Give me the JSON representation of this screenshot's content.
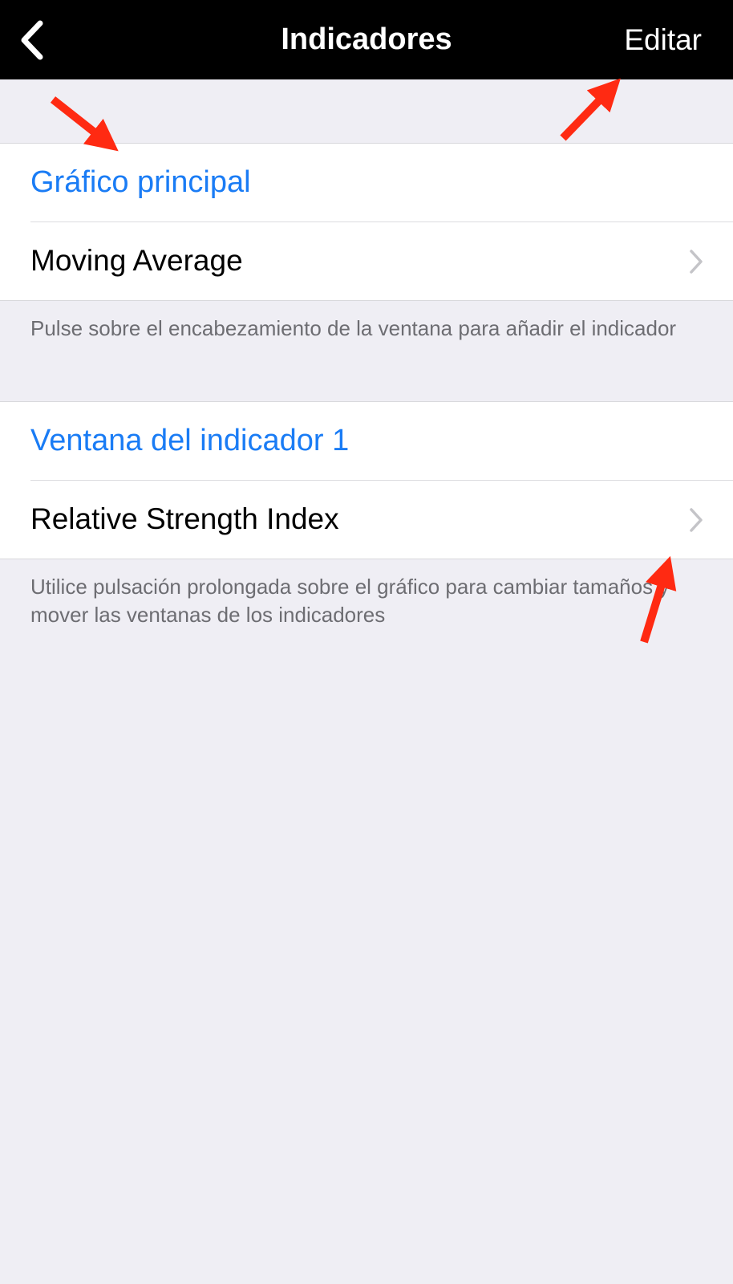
{
  "navbar": {
    "back_icon": "chevron-left-icon",
    "title": "Indicadores",
    "edit_label": "Editar"
  },
  "sections": [
    {
      "header": "Gráfico principal",
      "items": [
        {
          "label": "Moving Average",
          "icon": "chevron-right-icon"
        }
      ],
      "footer": "Pulse sobre el encabezamiento de la ventana para añadir el indicador"
    },
    {
      "header": "Ventana del indicador 1",
      "items": [
        {
          "label": "Relative Strength Index",
          "icon": "chevron-right-icon"
        }
      ],
      "footer": "Utilice pulsación prolongada sobre el gráfico para cambiar tamaños y mover las ventanas de los indicadores"
    }
  ],
  "colors": {
    "navbar_bg": "#000000",
    "accent_blue": "#1a7cf5",
    "page_bg": "#efeef4",
    "annotation_red": "#ff2a12"
  }
}
